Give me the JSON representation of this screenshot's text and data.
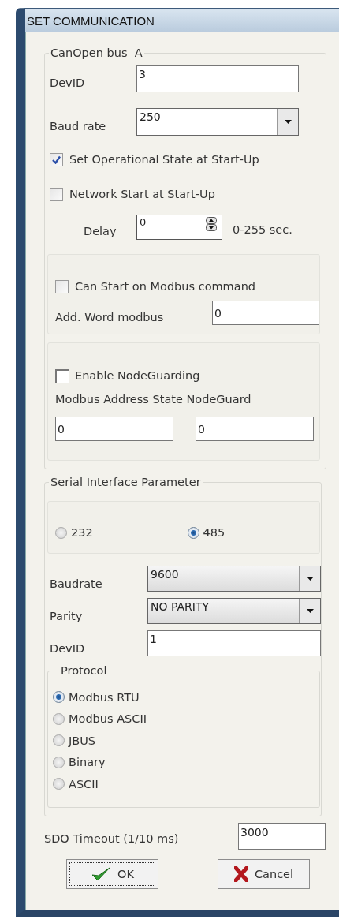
{
  "window": {
    "title": "SET COMMUNICATION"
  },
  "canopen": {
    "legend": "CanOpen bus  A",
    "devid": {
      "label": "DevID",
      "value": "3"
    },
    "baud_rate": {
      "label": "Baud rate",
      "value": "250"
    },
    "options": [
      {
        "label": "Set Operational State at Start-Up",
        "checked": true
      },
      {
        "label": "Network Start at Start-Up",
        "checked": false
      }
    ],
    "delay": {
      "label": "Delay",
      "value": "0",
      "range": "0-255 sec."
    },
    "modbus_start": {
      "label": "Can Start on Modbus command",
      "checked": false,
      "word_label": "Add. Word modbus",
      "word_value": "0"
    },
    "nodeguard": {
      "label": "Enable NodeGuarding",
      "checked": false,
      "address_label": "Modbus Address State NodeGuard",
      "values": [
        "0",
        "0"
      ]
    }
  },
  "serial": {
    "legend": "Serial Interface Parameter",
    "interfaces": [
      {
        "label": "232",
        "selected": false
      },
      {
        "label": "485",
        "selected": true
      }
    ],
    "baudrate": {
      "label": "Baudrate",
      "value": "9600"
    },
    "parity": {
      "label": "Parity",
      "value": "NO PARITY"
    },
    "devid": {
      "label": "DevID",
      "value": "1"
    },
    "protocol": {
      "legend": "Protocol",
      "options": [
        {
          "label": "Modbus RTU",
          "selected": true
        },
        {
          "label": "Modbus ASCII",
          "selected": false
        },
        {
          "label": "JBUS",
          "selected": false
        },
        {
          "label": "Binary",
          "selected": false
        },
        {
          "label": "ASCII",
          "selected": false
        }
      ]
    }
  },
  "sdo_timeout": {
    "label": "SDO Timeout (1/10 ms)",
    "value": "3000"
  },
  "buttons": [
    {
      "label": "OK",
      "kind": "ok"
    },
    {
      "label": "Cancel",
      "kind": "cancel"
    }
  ]
}
